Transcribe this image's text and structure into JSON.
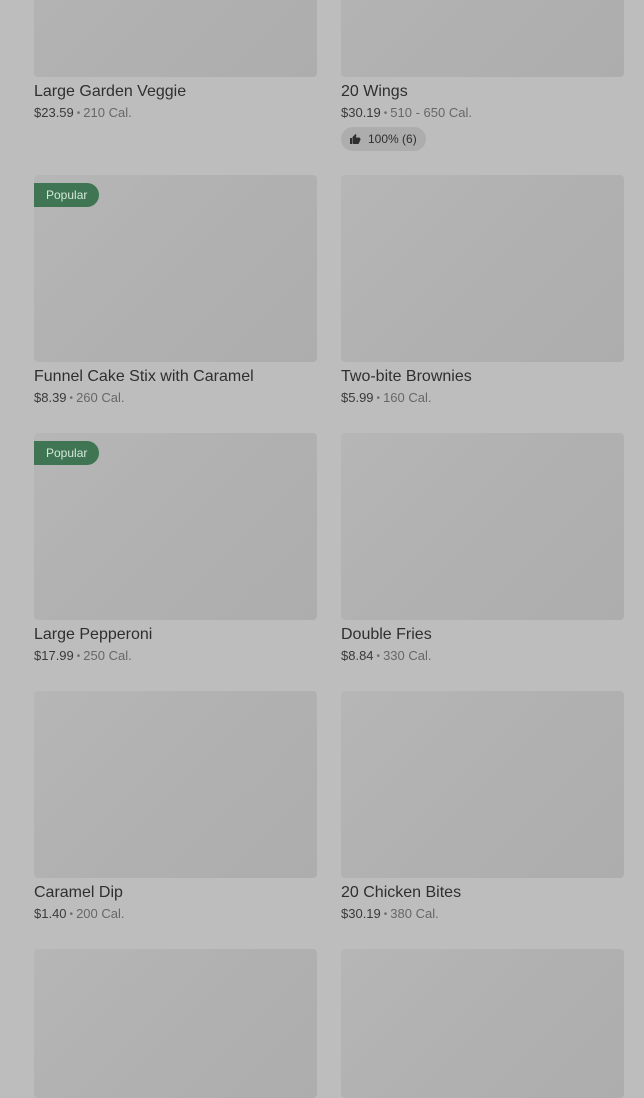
{
  "menu": {
    "items": [
      {
        "name": "Large Garden Veggie",
        "price": "$23.59",
        "calories": "210 Cal."
      },
      {
        "name": "20 Wings",
        "price": "$30.19",
        "calories": "510 - 650 Cal.",
        "rating": "100% (6)"
      },
      {
        "name": "Funnel Cake Stix with Caramel",
        "price": "$8.39",
        "calories": "260 Cal.",
        "badge": "Popular"
      },
      {
        "name": "Two-bite Brownies",
        "price": "$5.99",
        "calories": "160 Cal."
      },
      {
        "name": "Large Pepperoni",
        "price": "$17.99",
        "calories": "250 Cal.",
        "badge": "Popular"
      },
      {
        "name": "Double Fries",
        "price": "$8.84",
        "calories": "330 Cal."
      },
      {
        "name": "Caramel Dip",
        "price": "$1.40",
        "calories": "200 Cal."
      },
      {
        "name": "20 Chicken Bites",
        "price": "$30.19",
        "calories": "380 Cal."
      }
    ]
  },
  "icons": {
    "rating": "thumbs-up-icon"
  },
  "colors": {
    "badge_bg": "#3f7552",
    "badge_text": "#d5e7db"
  }
}
